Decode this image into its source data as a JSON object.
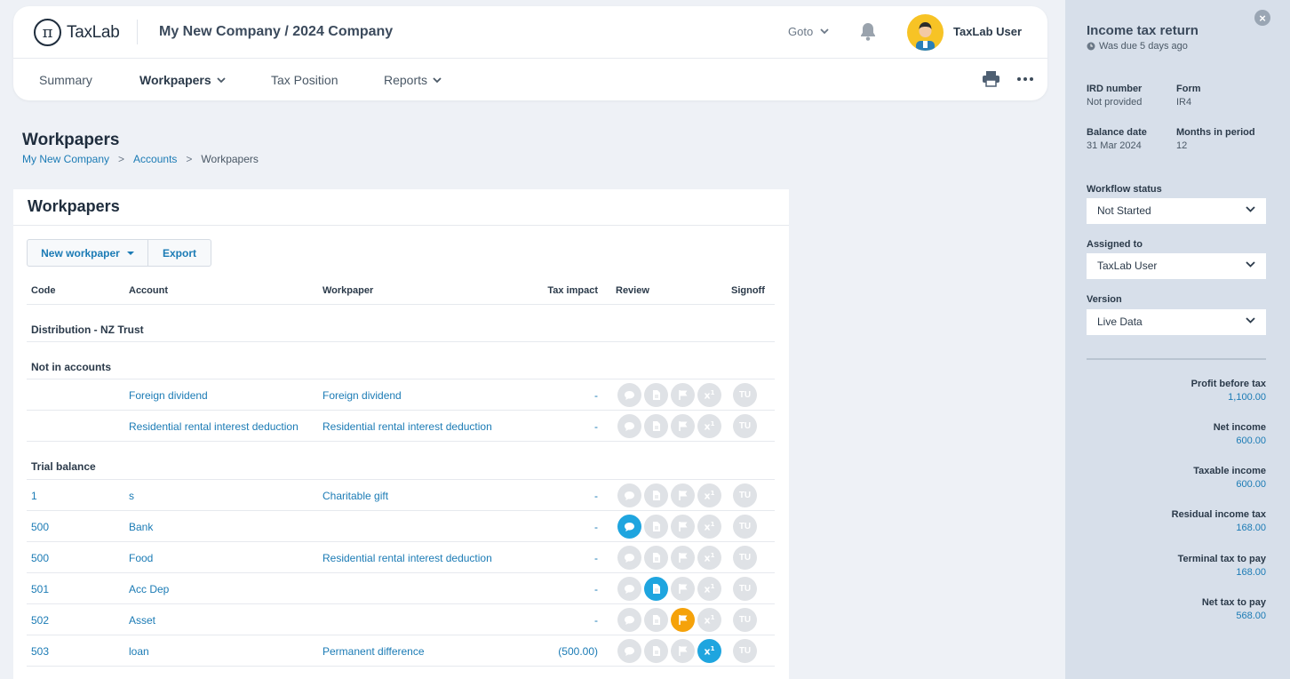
{
  "header": {
    "logo_text": "TaxLab",
    "logo_symbol": "π",
    "company": "My New Company / 2024 Company",
    "goto_label": "Goto",
    "user_name": "TaxLab User"
  },
  "nav": {
    "summary": "Summary",
    "workpapers": "Workpapers",
    "tax_position": "Tax Position",
    "reports": "Reports"
  },
  "page": {
    "title": "Workpapers",
    "breadcrumb": [
      "My New Company",
      "Accounts",
      "Workpapers"
    ],
    "breadcrumb_sep": ">"
  },
  "card": {
    "title": "Workpapers",
    "new_workpaper": "New workpaper",
    "export": "Export"
  },
  "table": {
    "headers": {
      "code": "Code",
      "account": "Account",
      "workpaper": "Workpaper",
      "tax_impact": "Tax impact",
      "review": "Review",
      "signoff": "Signoff"
    },
    "groups": {
      "distribution": "Distribution - NZ Trust",
      "not_in_accounts": "Not in accounts",
      "trial_balance": "Trial balance"
    },
    "rows": [
      {
        "code": "",
        "account": "Foreign dividend",
        "workpaper": "Foreign dividend",
        "tax": "-",
        "signoff": "TU"
      },
      {
        "code": "",
        "account": "Residential rental interest deduction",
        "workpaper": "Residential rental interest deduction",
        "tax": "-",
        "signoff": "TU"
      },
      {
        "code": "1",
        "account": "s",
        "workpaper": "Charitable gift",
        "tax": "-",
        "signoff": "TU"
      },
      {
        "code": "500",
        "account": "Bank",
        "workpaper": "",
        "tax": "-",
        "signoff": "TU"
      },
      {
        "code": "500",
        "account": "Food",
        "workpaper": "Residential rental interest deduction",
        "tax": "-",
        "signoff": "TU"
      },
      {
        "code": "501",
        "account": "Acc Dep",
        "workpaper": "",
        "tax": "-",
        "signoff": "TU"
      },
      {
        "code": "502",
        "account": "Asset",
        "workpaper": "",
        "tax": "-",
        "signoff": "TU"
      },
      {
        "code": "503",
        "account": "loan",
        "workpaper": "Permanent difference",
        "tax": "(500.00)",
        "signoff": "TU"
      }
    ],
    "review_icons": [
      "comment-icon",
      "document-icon",
      "flag-icon",
      "tax-difference-icon"
    ]
  },
  "side": {
    "title": "Income tax return",
    "due": "Was due 5 days ago",
    "ird_label": "IRD number",
    "ird_value": "Not provided",
    "form_label": "Form",
    "form_value": "IR4",
    "balance_label": "Balance date",
    "balance_value": "31 Mar 2024",
    "months_label": "Months in period",
    "months_value": "12",
    "workflow_label": "Workflow status",
    "workflow_value": "Not Started",
    "assigned_label": "Assigned to",
    "assigned_value": "TaxLab User",
    "version_label": "Version",
    "version_value": "Live Data",
    "summary": [
      {
        "label": "Profit before tax",
        "value": "1,100.00"
      },
      {
        "label": "Net income",
        "value": "600.00"
      },
      {
        "label": "Taxable income",
        "value": "600.00"
      },
      {
        "label": "Residual income tax",
        "value": "168.00"
      },
      {
        "label": "Terminal tax to pay",
        "value": "168.00"
      },
      {
        "label": "Net tax to pay",
        "value": "568.00"
      }
    ]
  },
  "colors": {
    "accent_blue": "#1fa5df",
    "flag_orange": "#f5a20a",
    "link": "#1b7bb5"
  }
}
